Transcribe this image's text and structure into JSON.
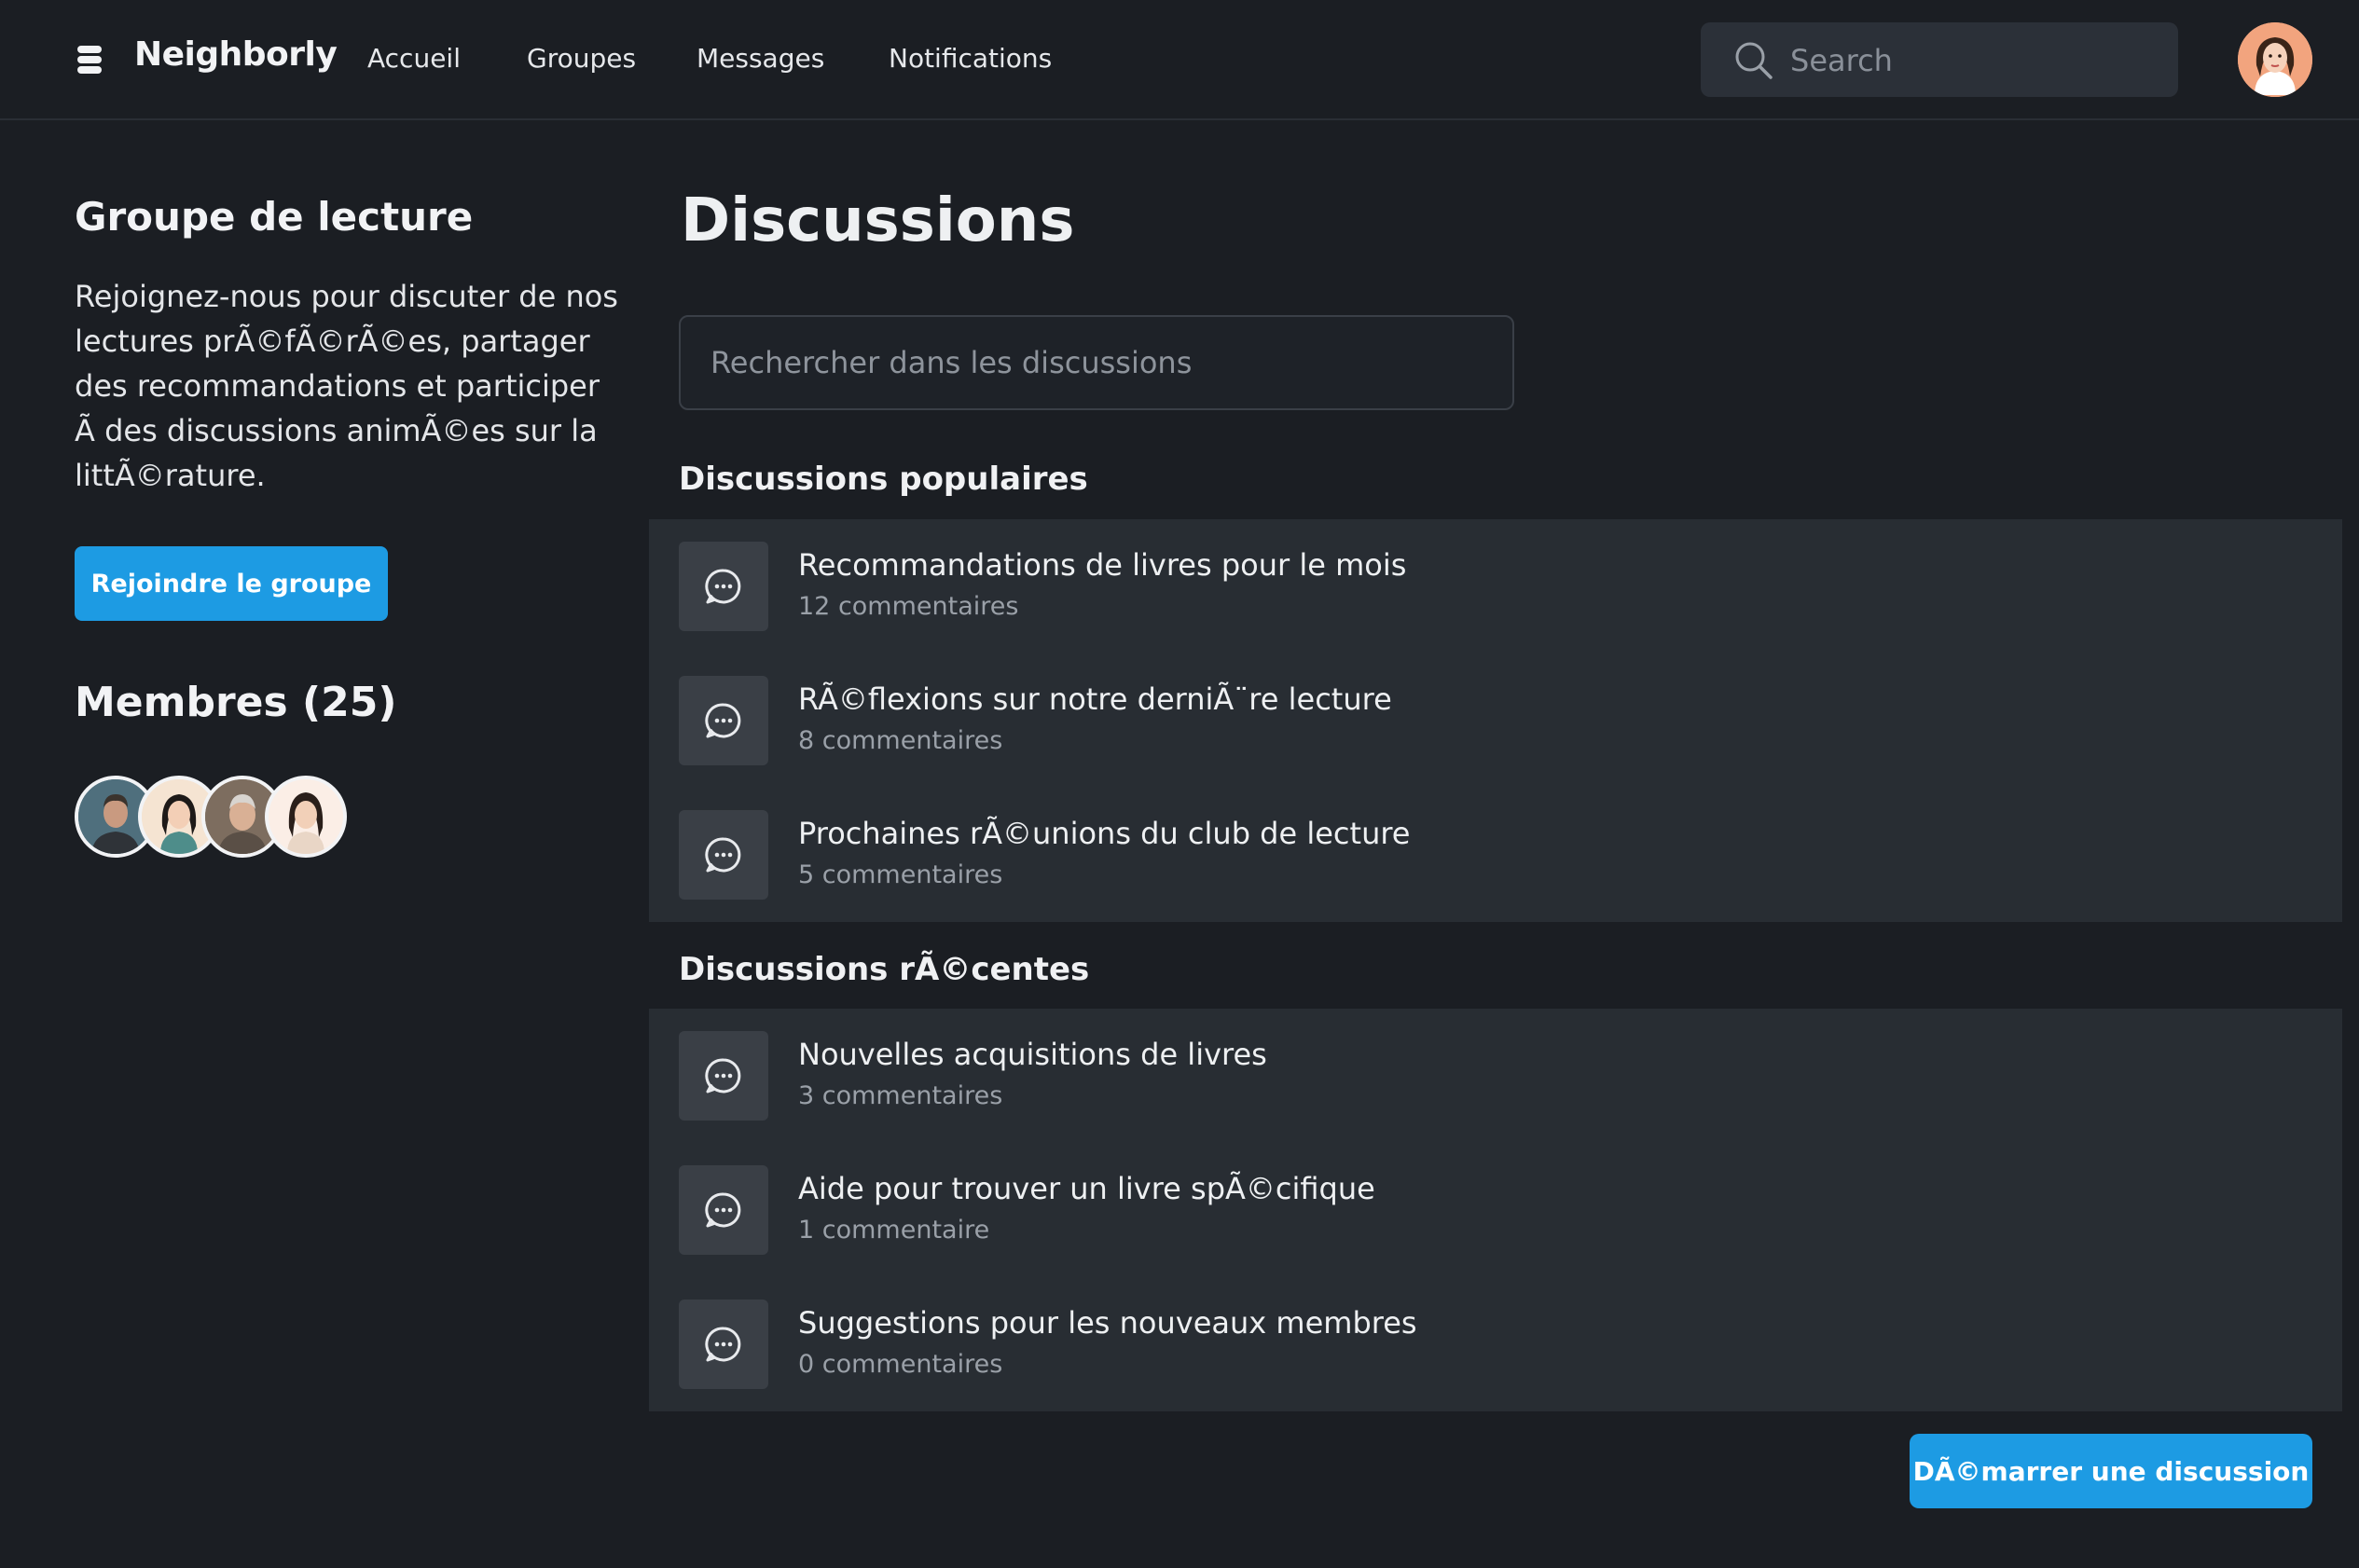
{
  "header": {
    "brand": "Neighborly",
    "nav": [
      "Accueil",
      "Groupes",
      "Messages",
      "Notifications"
    ],
    "search_placeholder": "Search"
  },
  "sidebar": {
    "group_title": "Groupe de lecture",
    "description": "Rejoignez-nous pour discuter de nos lectures prÃ©fÃ©rÃ©es, partager des recommandations et participer Ã  des discussions animÃ©es sur la littÃ©rature.",
    "join_label": "Rejoindre le groupe",
    "members_title": "Membres (25)"
  },
  "main": {
    "title": "Discussions",
    "search_placeholder": "Rechercher dans les discussions",
    "popular_title": "Discussions populaires",
    "popular": [
      {
        "title": "Recommandations de livres pour le mois",
        "count": "12 commentaires"
      },
      {
        "title": "RÃ©flexions sur notre derniÃ¨re lecture",
        "count": "8 commentaires"
      },
      {
        "title": "Prochaines rÃ©unions du club de lecture",
        "count": "5 commentaires"
      }
    ],
    "recent_title": "Discussions rÃ©centes",
    "recent": [
      {
        "title": "Nouvelles acquisitions de livres",
        "count": "3 commentaires"
      },
      {
        "title": "Aide pour trouver un livre spÃ©cifique",
        "count": "1 commentaire"
      },
      {
        "title": "Suggestions pour les nouveaux membres",
        "count": "0 commentaires"
      }
    ],
    "start_label": "DÃ©marrer une discussion"
  },
  "colors": {
    "background": "#1b1e23",
    "panel": "#282d33",
    "accent": "#1d9be3"
  },
  "icons": [
    "stack-logo-icon",
    "search-icon",
    "chat-bubble-icon"
  ]
}
